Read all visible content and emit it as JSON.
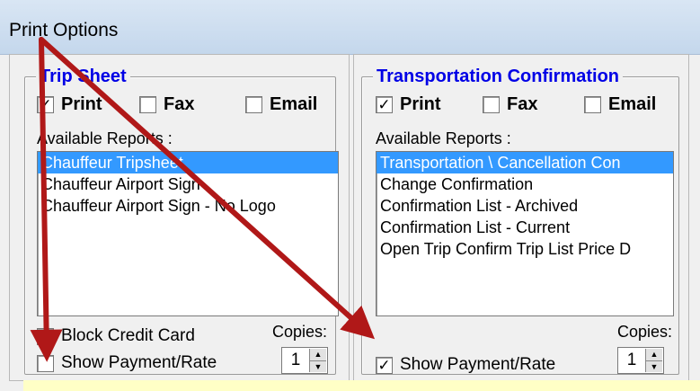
{
  "window": {
    "title": "Print Options"
  },
  "trip_sheet": {
    "legend": "Trip Sheet",
    "print_label": "Print",
    "print_checked": true,
    "fax_label": "Fax",
    "fax_checked": false,
    "email_label": "Email",
    "email_checked": false,
    "reports_label": "Available Reports :",
    "reports": [
      "Chauffeur Tripsheet",
      "Chauffeur Airport Sign",
      "Chauffeur Airport Sign - No Logo"
    ],
    "selected_index": 0,
    "block_cc_label": "Block Credit Card",
    "block_cc_checked": false,
    "show_payment_label": "Show Payment/Rate",
    "show_payment_checked": false,
    "copies_label": "Copies:",
    "copies_value": "1"
  },
  "transport_conf": {
    "legend": "Transportation Confirmation",
    "print_label": "Print",
    "print_checked": true,
    "fax_label": "Fax",
    "fax_checked": false,
    "email_label": "Email",
    "email_checked": false,
    "reports_label": "Available Reports :",
    "reports": [
      "Transportation \\ Cancellation Con",
      "Change Confirmation",
      "Confirmation List - Archived",
      "Confirmation List - Current",
      "Open Trip Confirm Trip List Price D"
    ],
    "selected_index": 0,
    "show_payment_label": "Show Payment/Rate",
    "show_payment_checked": true,
    "copies_label": "Copies:",
    "copies_value": "1"
  },
  "glyphs": {
    "check": "✓",
    "up": "▲",
    "down": "▼"
  },
  "colors": {
    "accent": "#0000e6",
    "selection": "#3399ff",
    "arrow": "#b01818"
  }
}
